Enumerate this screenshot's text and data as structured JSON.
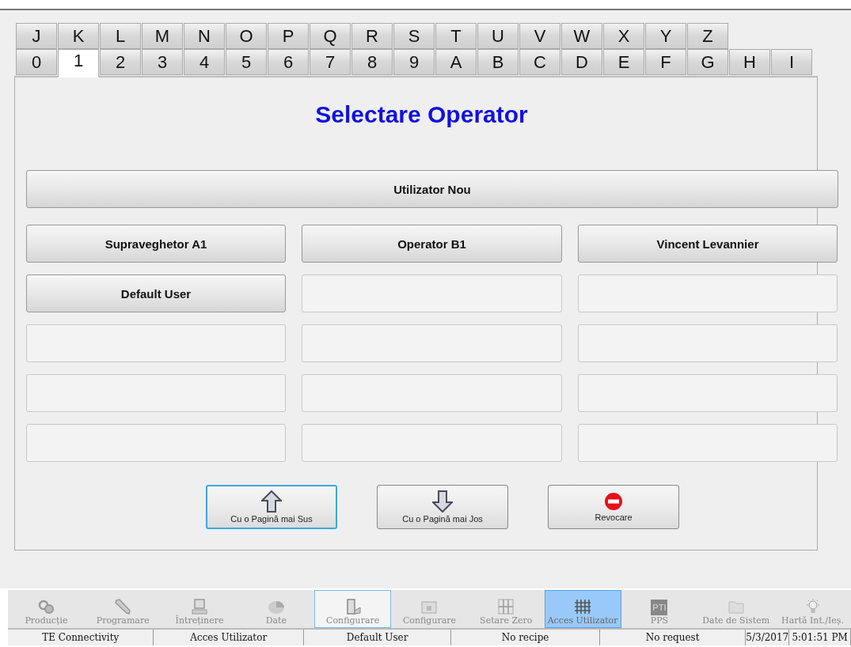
{
  "tabs": {
    "rows": [
      [
        {
          "label": "J",
          "selected": false
        },
        {
          "label": "K",
          "selected": false
        },
        {
          "label": "L",
          "selected": false
        },
        {
          "label": "M",
          "selected": false
        },
        {
          "label": "N",
          "selected": false
        },
        {
          "label": "O",
          "selected": false
        },
        {
          "label": "P",
          "selected": false
        },
        {
          "label": "Q",
          "selected": false
        },
        {
          "label": "R",
          "selected": false
        },
        {
          "label": "S",
          "selected": false
        },
        {
          "label": "T",
          "selected": false
        },
        {
          "label": "U",
          "selected": false
        },
        {
          "label": "V",
          "selected": false
        },
        {
          "label": "W",
          "selected": false
        },
        {
          "label": "X",
          "selected": false
        },
        {
          "label": "Y",
          "selected": false
        },
        {
          "label": "Z",
          "selected": false
        }
      ],
      [
        {
          "label": "0",
          "selected": false
        },
        {
          "label": "1",
          "selected": true
        },
        {
          "label": "2",
          "selected": false
        },
        {
          "label": "3",
          "selected": false
        },
        {
          "label": "4",
          "selected": false
        },
        {
          "label": "5",
          "selected": false
        },
        {
          "label": "6",
          "selected": false
        },
        {
          "label": "7",
          "selected": false
        },
        {
          "label": "8",
          "selected": false
        },
        {
          "label": "9",
          "selected": false
        },
        {
          "label": "A",
          "selected": false
        },
        {
          "label": "B",
          "selected": false
        },
        {
          "label": "C",
          "selected": false
        },
        {
          "label": "D",
          "selected": false
        },
        {
          "label": "E",
          "selected": false
        },
        {
          "label": "F",
          "selected": false
        },
        {
          "label": "G",
          "selected": false
        },
        {
          "label": "H",
          "selected": false
        },
        {
          "label": "I",
          "selected": false
        }
      ]
    ]
  },
  "title": "Selectare Operator",
  "new_user_button": "Utilizator Nou",
  "operator_slots": [
    {
      "kind": "user",
      "label": "Supraveghetor A1"
    },
    {
      "kind": "user",
      "label": "Operator B1"
    },
    {
      "kind": "user",
      "label": "Vincent Levannier"
    },
    {
      "kind": "user",
      "label": "Default User"
    },
    {
      "kind": "empty"
    },
    {
      "kind": "empty"
    },
    {
      "kind": "empty"
    },
    {
      "kind": "empty"
    },
    {
      "kind": "empty"
    },
    {
      "kind": "empty"
    },
    {
      "kind": "empty"
    },
    {
      "kind": "empty"
    },
    {
      "kind": "empty"
    },
    {
      "kind": "empty"
    },
    {
      "kind": "empty"
    }
  ],
  "nav_buttons": [
    {
      "kind": "up",
      "label": "Cu o Pagină mai Sus",
      "focused": true
    },
    {
      "kind": "down",
      "label": "Cu o Pagină mai Jos",
      "focused": false
    },
    {
      "kind": "cancel",
      "label": "Revocare",
      "focused": false
    }
  ],
  "toolbar": [
    {
      "label": "Producție",
      "selected": false,
      "outlined": false
    },
    {
      "label": "Programare",
      "selected": false,
      "outlined": false
    },
    {
      "label": "Întreținere",
      "selected": false,
      "outlined": false
    },
    {
      "label": "Date",
      "selected": false,
      "outlined": false
    },
    {
      "label": "Configurare",
      "selected": false,
      "outlined": true
    },
    {
      "label": "Configurare",
      "selected": false,
      "outlined": false
    },
    {
      "label": "Setare Zero",
      "selected": false,
      "outlined": false
    },
    {
      "label": "Acces Utilizator",
      "selected": true,
      "outlined": false
    },
    {
      "label": "PPS",
      "icon_text": "PTI",
      "selected": false,
      "outlined": false
    },
    {
      "label": "Date de Sistem",
      "selected": false,
      "outlined": false
    },
    {
      "label": "Hartă Int./Ieș.",
      "selected": false,
      "outlined": false
    }
  ],
  "status_bar": [
    "TE Connectivity",
    "Acces Utilizator",
    "Default User",
    "No recipe",
    "No request",
    "5/3/2017",
    "5:01:51 PM"
  ]
}
